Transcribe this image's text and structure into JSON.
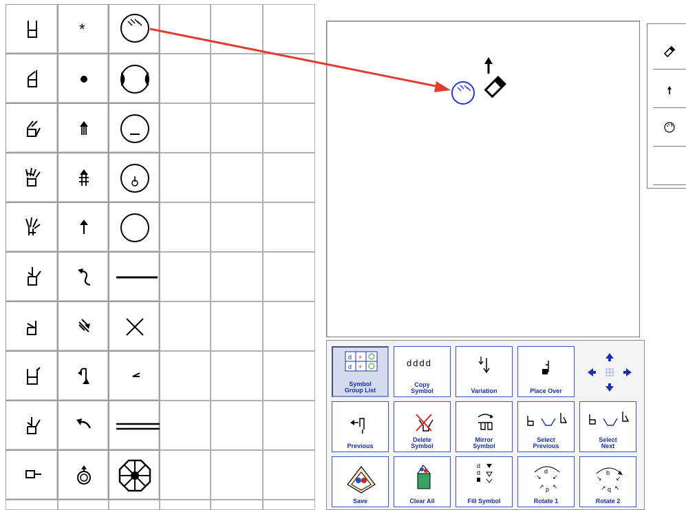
{
  "palette": {
    "columns": 6,
    "rows": 10,
    "col1_symbols": [
      "hand-flat-icon",
      "hand-bent-icon",
      "hand-thumb-out-icon",
      "hand-claw-icon",
      "hand-spread-icon",
      "hand-index-thumb-icon",
      "hand-angle-icon",
      "hand-u-icon",
      "hand-hook-icon",
      "hand-point-side-icon"
    ],
    "col2_symbols": [
      "star-contact-icon",
      "dot-contact-icon",
      "double-arrow-up-icon",
      "double-hash-arrow-icon",
      "arrow-up-icon",
      "curve-arrow-icon",
      "diagonal-arrow-icon",
      "hook-arrow-icon",
      "curved-back-arrow-icon",
      "circle-arrow-icon"
    ],
    "col3_symbols": [
      "face-eyebrows-icon",
      "face-cheeks-icon",
      "face-mouth-icon",
      "face-nose-icon",
      "face-circle-icon",
      "horizontal-line-icon",
      "cross-icon",
      "small-angle-icon",
      "double-line-icon",
      "octagon-wheel-icon"
    ]
  },
  "canvas": {
    "placed_symbols": [
      "face-eyebrows-icon",
      "arrow-up-icon",
      "hand-marker-icon"
    ],
    "selected_color": "#2233dd"
  },
  "annotation": {
    "arrow_color": "#e53a2e"
  },
  "sequence": {
    "items": [
      "hand-marker-icon",
      "arrow-up-icon",
      "face-eyebrows-icon",
      ""
    ]
  },
  "toolbar": {
    "symbol_group_list": "Symbol\nGroup List",
    "copy_symbol": "Copy\nSymbol",
    "variation": "Variation",
    "place_over": "Place Over",
    "previous": "Previous",
    "delete_symbol": "Delete\nSymbol",
    "mirror_symbol": "Mirror\nSymbol",
    "select_previous": "Select\nPrevious",
    "select_next": "Select\nNext",
    "save": "Save",
    "clear_all": "Clear All",
    "fill_symbol": "Fill Symbol",
    "rotate_1": "Rotate 1",
    "rotate_2": "Rotate 2",
    "accent": "#1a2fb0"
  }
}
